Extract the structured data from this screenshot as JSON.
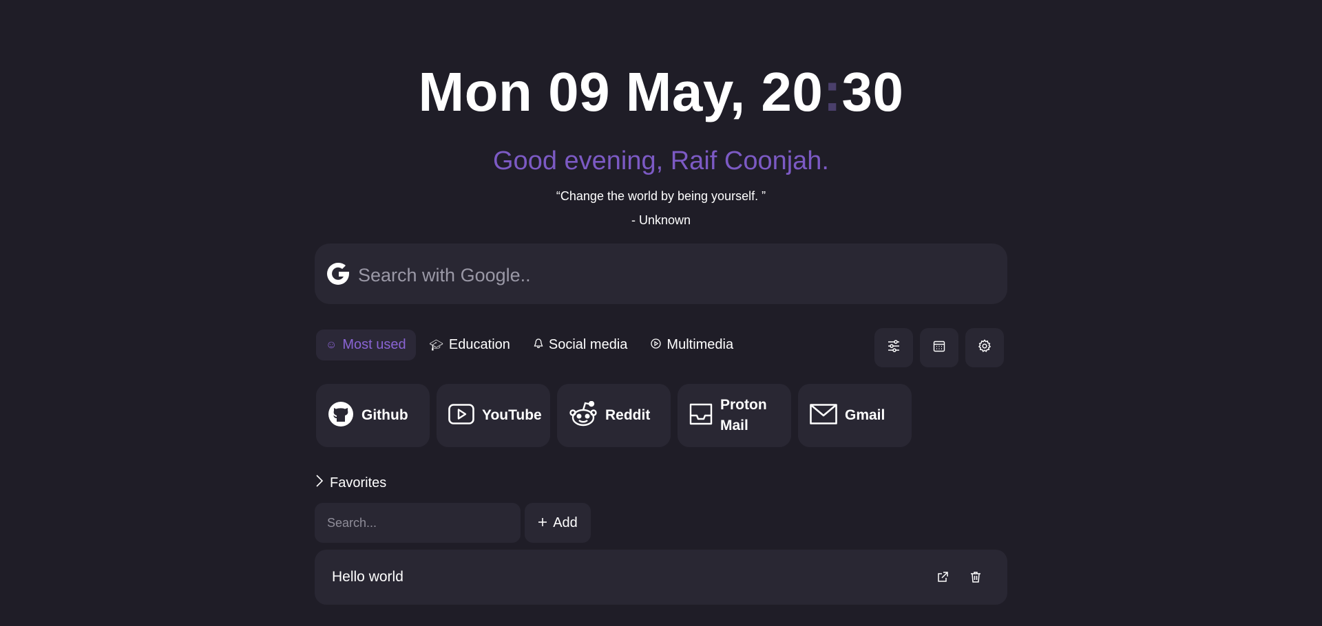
{
  "clock": {
    "date": "Mon 09 May, ",
    "hours": "20",
    "separator": ":",
    "minutes": "30"
  },
  "greeting": "Good evening, Raif Coonjah.",
  "quote": {
    "text": "“Change the world by being yourself. ”",
    "author": "- Unknown"
  },
  "search": {
    "placeholder": "Search with Google..",
    "engine_icon": "google-icon"
  },
  "categories": [
    {
      "label": "Most used",
      "icon": "smile-icon",
      "active": true
    },
    {
      "label": "Education",
      "icon": "graduation-cap-icon",
      "active": false
    },
    {
      "label": "Social media",
      "icon": "bell-icon",
      "active": false
    },
    {
      "label": "Multimedia",
      "icon": "play-circle-icon",
      "active": false
    }
  ],
  "tools": [
    {
      "icon": "sliders-icon"
    },
    {
      "icon": "calendar-icon"
    },
    {
      "icon": "gear-icon"
    }
  ],
  "links": [
    {
      "label": "Github",
      "icon": "github-icon"
    },
    {
      "label": "YouTube",
      "icon": "youtube-icon"
    },
    {
      "label": "Reddit",
      "icon": "reddit-icon"
    },
    {
      "label": "Proton Mail",
      "icon": "inbox-icon"
    },
    {
      "label": "Gmail",
      "icon": "mail-icon"
    }
  ],
  "favorites": {
    "title": "Favorites",
    "search_placeholder": "Search...",
    "add_label": "Add",
    "items": [
      {
        "label": "Hello world"
      }
    ]
  },
  "colors": {
    "background": "#1f1d27",
    "card": "#292733",
    "accent": "#7c5ac4",
    "text": "#ffffff"
  }
}
